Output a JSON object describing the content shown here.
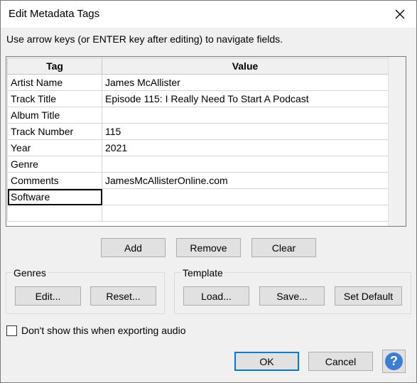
{
  "window": {
    "title": "Edit Metadata Tags",
    "close_symbol": "✕"
  },
  "instructions": "Use arrow keys (or ENTER key after editing) to navigate fields.",
  "table": {
    "columns": [
      "Tag",
      "Value"
    ],
    "rows": [
      {
        "tag": "Artist Name",
        "value": "James McAllister"
      },
      {
        "tag": "Track Title",
        "value": "Episode 115: I Really Need To Start A Podcast"
      },
      {
        "tag": "Album Title",
        "value": ""
      },
      {
        "tag": "Track Number",
        "value": "115"
      },
      {
        "tag": "Year",
        "value": "2021"
      },
      {
        "tag": "Genre",
        "value": ""
      },
      {
        "tag": "Comments",
        "value": "JamesMcAllisterOnline.com"
      },
      {
        "tag": "Software",
        "value": ""
      },
      {
        "tag": "",
        "value": ""
      }
    ],
    "selected_row": 7
  },
  "row_buttons": {
    "add": "Add",
    "remove": "Remove",
    "clear": "Clear"
  },
  "genres": {
    "label": "Genres",
    "edit": "Edit...",
    "reset": "Reset..."
  },
  "template": {
    "label": "Template",
    "load": "Load...",
    "save": "Save...",
    "set_default": "Set Default"
  },
  "checkbox": {
    "label": "Don't show this when exporting audio",
    "checked": false
  },
  "footer": {
    "ok": "OK",
    "cancel": "Cancel",
    "help_symbol": "?"
  },
  "colors": {
    "accent": "#0078d7",
    "help": "#3a7fd5"
  }
}
